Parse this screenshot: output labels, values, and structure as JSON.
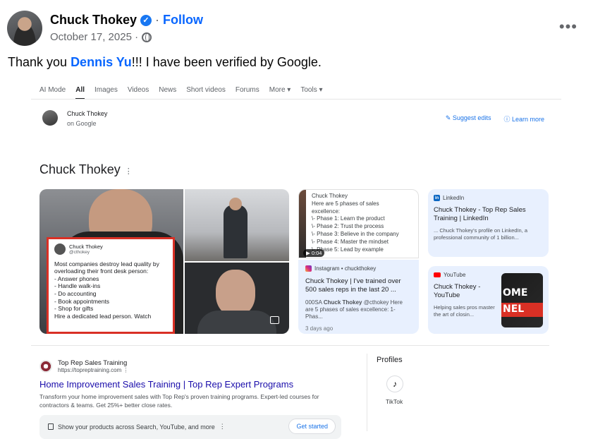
{
  "post": {
    "author": "Chuck Thokey",
    "separator": "·",
    "follow": "Follow",
    "date": "October 17, 2025 ·",
    "more": "•••",
    "text_before": "Thank you ",
    "mention": "Dennis Yu",
    "text_after": "!!! I have been verified by Google."
  },
  "google": {
    "tabs": [
      "AI Mode",
      "All",
      "Images",
      "Videos",
      "News",
      "Short videos",
      "Forums",
      "More ▾",
      "Tools ▾"
    ],
    "active_tab_index": 1,
    "kp_name": "Chuck Thokey",
    "kp_sub": "on Google",
    "suggest_edits": "Suggest edits",
    "learn_more": "Learn more",
    "entity_title": "Chuck Thokey",
    "entity_menu": "⋮",
    "tweet": {
      "name": "Chuck Thokey",
      "handle": "@cthokey",
      "lines": [
        "Most companies destroy lead quality by",
        "overloading their front desk person:",
        "- Answer phones",
        "- Handle walk-ins",
        "- Do accounting",
        "- Book appointments",
        "- Shop for gifts",
        "Hire a dedicated lead person. Watch"
      ]
    },
    "video": {
      "lines": [
        "Chuck Thokey",
        "Here are 5 phases of sales",
        "excellence:",
        "",
        "\\- Phase 1: Learn the product",
        "\\- Phase 2: Trust the process",
        "\\- Phase 3: Believe in the company",
        "\\- Phase 4: Master the mindset",
        "\\- Phase 5: Lead by example"
      ],
      "duration": "0:04"
    },
    "instagram": {
      "source": "Instagram • chuckthokey",
      "title": "Chuck Thokey | I've trained over 500 sales reps in the last 20 ...",
      "snippet_prefix": "000SA ",
      "snippet_bold": "Chuck Thokey",
      "snippet_rest": " @cthokey Here are 5 phases of sales excellence: 1- Phas...",
      "date": "3 days ago"
    },
    "linkedin": {
      "source": "LinkedIn",
      "title": "Chuck Thokey - Top Rep Sales Training | LinkedIn",
      "snippet": "... Chuck Thokey's profile on LinkedIn, a professional community of 1 billion..."
    },
    "youtube": {
      "source": "YouTube",
      "title": "Chuck Thokey - YouTube",
      "snippet": "Helping sales pros master the art of closin...",
      "thumb_text_1": "OME",
      "thumb_text_2": "NEL"
    },
    "result": {
      "site": "Top Rep Sales Training",
      "url": "https://topreptraining.com",
      "url_menu": "⋮",
      "title": "Home Improvement Sales Training | Top Rep Expert Programs",
      "description": "Transform your home improvement sales with Top Rep's proven training programs. Expert-led courses for contractors & teams. Get 25%+ better close rates."
    },
    "promo": {
      "text": "Show your products across Search, YouTube, and more",
      "menu": "⋮",
      "button": "Get started"
    },
    "profiles": {
      "title": "Profiles",
      "tiktok_label": "TikTok",
      "tiktok_glyph": "♪"
    }
  },
  "colors": {
    "facebook_blue": "#0866ff",
    "verified_blue": "#1877f2",
    "google_link": "#1a0dab",
    "google_blue": "#1a73e8",
    "card_bg": "#e8f0fe"
  },
  "icons": [
    "verified-badge-icon",
    "globe-icon",
    "more-options-icon",
    "pencil-icon",
    "info-icon",
    "gallery-icon",
    "instagram-icon",
    "linkedin-icon",
    "youtube-icon",
    "shopping-bag-icon",
    "tiktok-icon"
  ]
}
